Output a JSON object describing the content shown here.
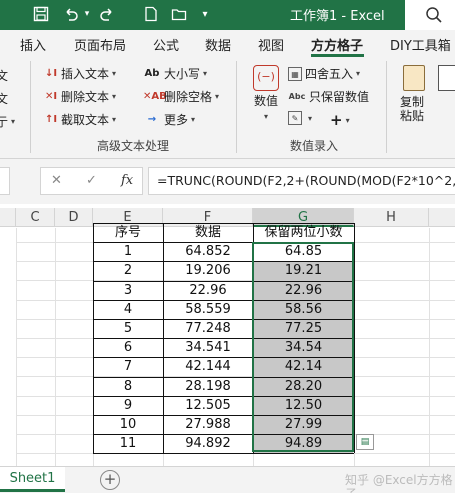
{
  "titlebar": {
    "title": "工作簿1 - Excel",
    "save_icon": "save-icon",
    "undo_icon": "undo-icon",
    "redo_icon": "redo-icon"
  },
  "tabs": [
    {
      "label": "插入",
      "active": false
    },
    {
      "label": "页面布局",
      "active": false
    },
    {
      "label": "公式",
      "active": false
    },
    {
      "label": "数据",
      "active": false
    },
    {
      "label": "视图",
      "active": false
    },
    {
      "label": "方方格子",
      "active": true
    },
    {
      "label": "DIY工具箱",
      "active": false
    }
  ],
  "ribbon": {
    "text_group": {
      "insert_text": "插入文本",
      "delete_text": "删除文本",
      "extract_text": "截取文本",
      "case": "大小写",
      "delete_space": "删除空格",
      "more": "更多",
      "label": "高级文本处理"
    },
    "number_group": {
      "value": "数值",
      "round": "四舍五入",
      "keep_value": "只保留数值",
      "label": "数值录入",
      "plus": "+"
    },
    "copy_paste": "复制粘贴"
  },
  "formula_bar": {
    "cancel": "✕",
    "confirm": "✓",
    "fx": "fx",
    "formula": "=TRUNC(ROUND(F2,2+(ROUND(MOD(F2*10^2,2)"
  },
  "columns": [
    "C",
    "D",
    "E",
    "F",
    "G",
    "H"
  ],
  "table": {
    "headers": [
      "序号",
      "数据",
      "保留两位小数"
    ],
    "rows": [
      [
        "1",
        "64.852",
        "64.85"
      ],
      [
        "2",
        "19.206",
        "19.21"
      ],
      [
        "3",
        "22.96",
        "22.96"
      ],
      [
        "4",
        "58.559",
        "58.56"
      ],
      [
        "5",
        "77.248",
        "77.25"
      ],
      [
        "6",
        "34.541",
        "34.54"
      ],
      [
        "7",
        "42.144",
        "42.14"
      ],
      [
        "8",
        "28.198",
        "28.20"
      ],
      [
        "9",
        "12.505",
        "12.50"
      ],
      [
        "10",
        "27.988",
        "27.99"
      ],
      [
        "11",
        "94.892",
        "94.89"
      ]
    ]
  },
  "sheets": {
    "active": "Sheet1",
    "add": "+"
  },
  "watermark": "知乎 @Excel方方格子"
}
